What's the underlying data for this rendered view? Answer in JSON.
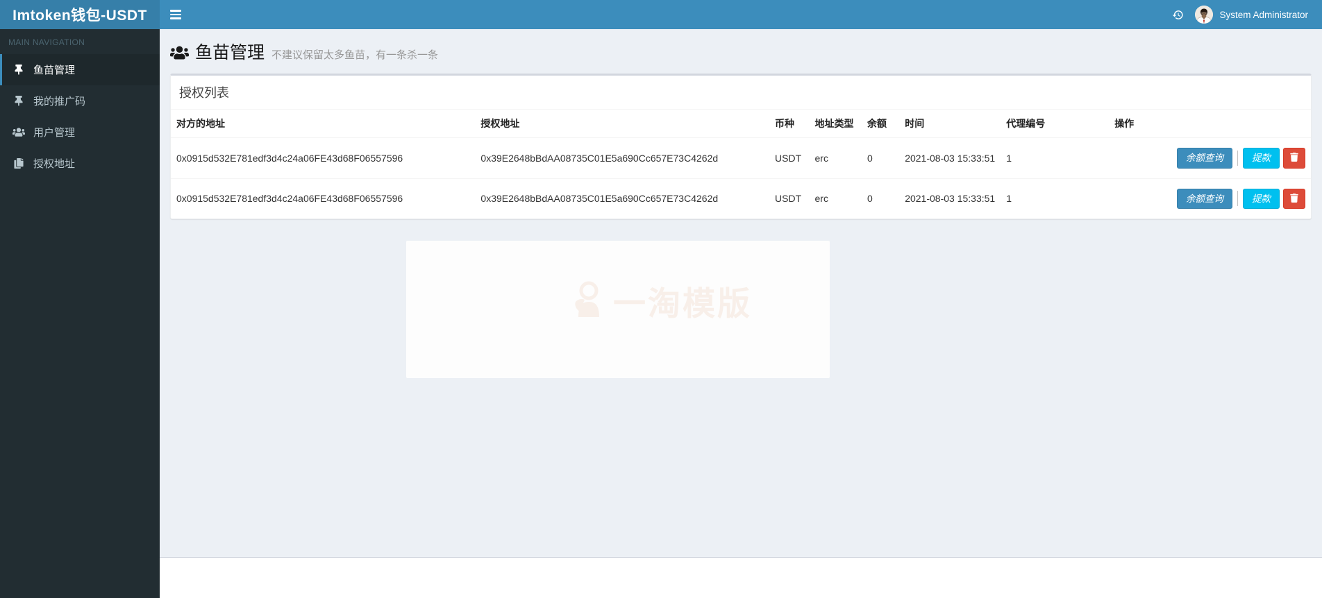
{
  "colors": {
    "navbar": "#3c8dbc",
    "logo_bg": "#367fa9",
    "sidebar_bg": "#222d32",
    "sidebar_active_bg": "#1e282c",
    "primary_button": "#3c8dbc",
    "info_button": "#00c0ef",
    "danger_button": "#dd4b39",
    "content_bg": "#ecf0f5"
  },
  "navbar": {
    "brand": "Imtoken钱包-USDT",
    "user_name": "System Administrator"
  },
  "sidebar": {
    "section_label": "MAIN NAVIGATION",
    "items": [
      {
        "label": "鱼苗管理",
        "icon": "thumbtack-icon",
        "active": true
      },
      {
        "label": "我的推广码",
        "icon": "thumbtack-icon",
        "active": false
      },
      {
        "label": "用户管理",
        "icon": "users-icon",
        "active": false
      },
      {
        "label": "授权地址",
        "icon": "copy-icon",
        "active": false
      }
    ]
  },
  "page": {
    "title": "鱼苗管理",
    "subtitle": "不建议保留太多鱼苗，有一条杀一条"
  },
  "panel": {
    "title": "授权列表",
    "headers": [
      "对方的地址",
      "授权地址",
      "币种",
      "地址类型",
      "余额",
      "时间",
      "代理编号",
      "操作"
    ],
    "rows": [
      {
        "peer_address": "0x0915d532E781edf3d4c24a06FE43d68F06557596",
        "auth_address": "0x39E2648bBdAA08735C01E5a690Cc657E73C4262d",
        "coin": "USDT",
        "address_type": "erc",
        "balance": "0",
        "time": "2021-08-03 15:33:51",
        "agent_no": "1"
      },
      {
        "peer_address": "0x0915d532E781edf3d4c24a06FE43d68F06557596",
        "auth_address": "0x39E2648bBdAA08735C01E5a690Cc657E73C4262d",
        "coin": "USDT",
        "address_type": "erc",
        "balance": "0",
        "time": "2021-08-03 15:33:51",
        "agent_no": "1"
      }
    ],
    "actions": {
      "balance_query": "余额查询",
      "withdraw": "提款"
    }
  },
  "watermark": {
    "text": "一淘模版"
  }
}
